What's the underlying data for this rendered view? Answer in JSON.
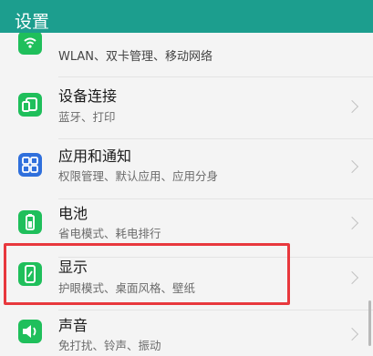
{
  "header": {
    "title": "设置"
  },
  "items": [
    {
      "title": "",
      "subtitle": "WLAN、双卡管理、移动网络",
      "icon": "wifi-icon"
    },
    {
      "title": "设备连接",
      "subtitle": "蓝牙、打印",
      "icon": "device-connection-icon"
    },
    {
      "title": "应用和通知",
      "subtitle": "权限管理、默认应用、应用分身",
      "icon": "apps-grid-icon"
    },
    {
      "title": "电池",
      "subtitle": "省电模式、耗电排行",
      "icon": "battery-icon"
    },
    {
      "title": "显示",
      "subtitle": "护眼模式、桌面风格、壁纸",
      "icon": "display-icon"
    },
    {
      "title": "声音",
      "subtitle": "免打扰、铃声、振动",
      "icon": "speaker-icon"
    }
  ],
  "colors": {
    "header": "#1c9e8e",
    "icon_green": "#1fbf5b",
    "icon_blue": "#2f6fdc",
    "highlight": "#e8383d"
  }
}
